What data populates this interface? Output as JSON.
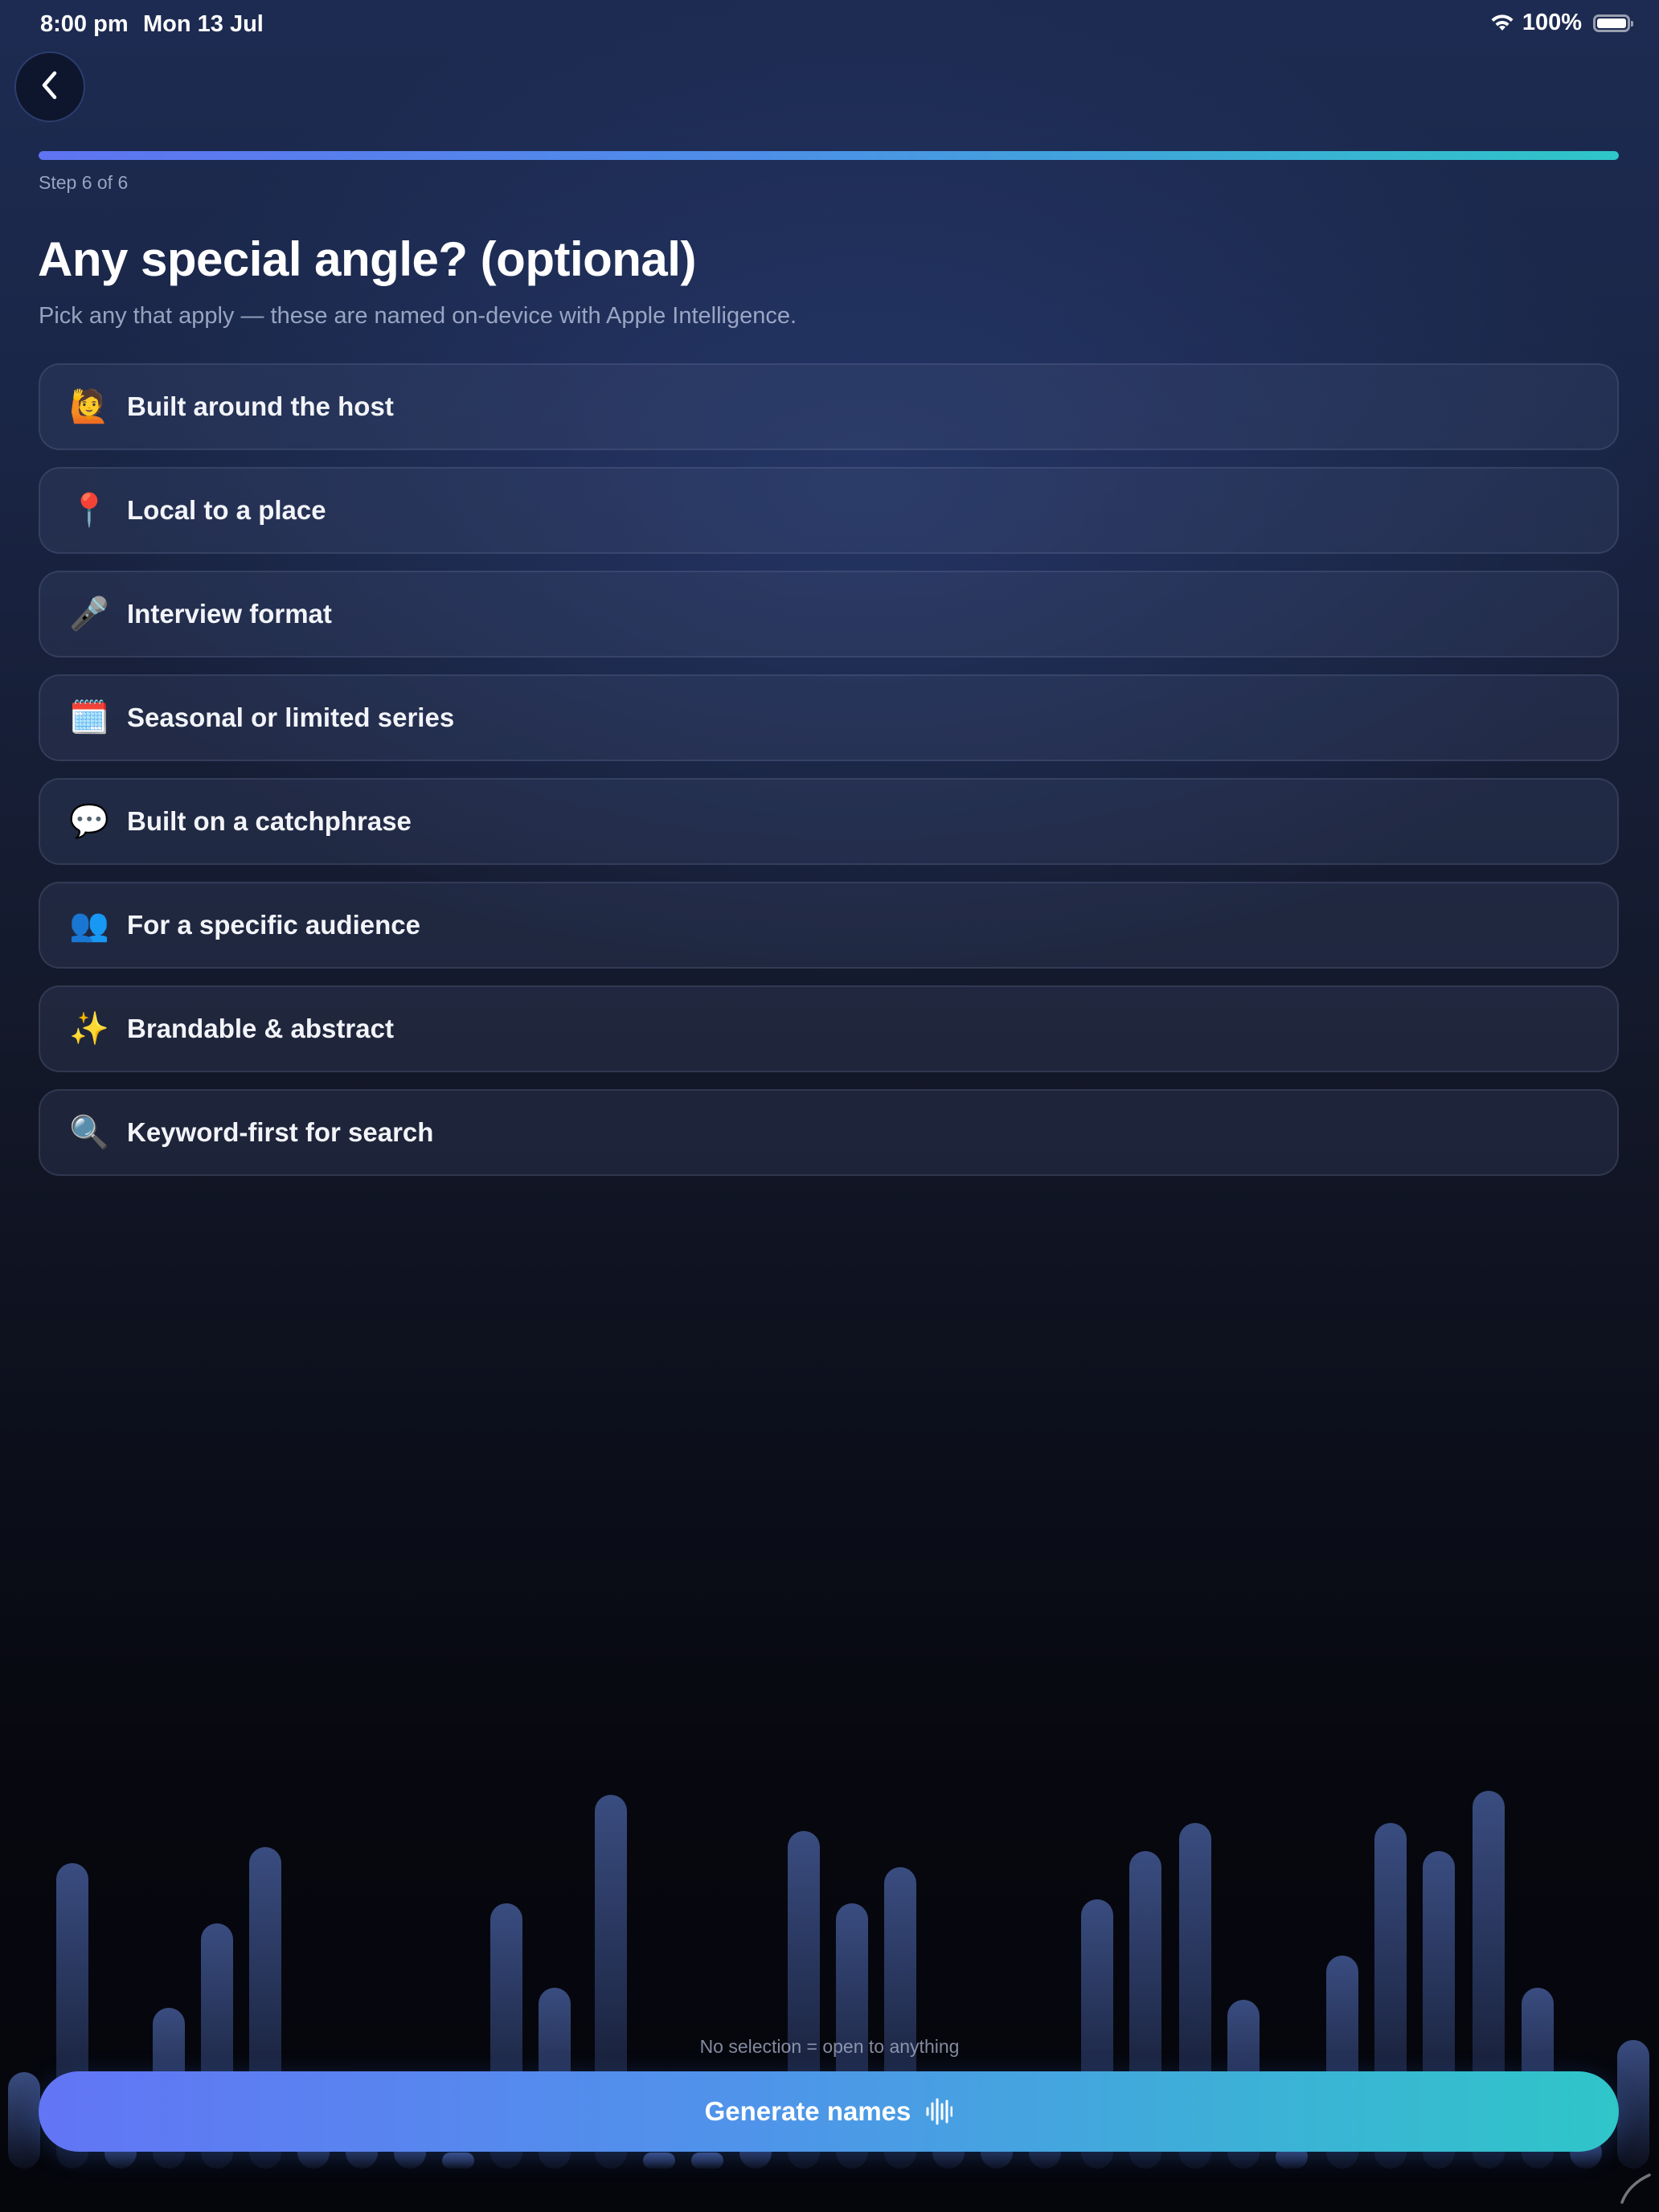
{
  "status_bar": {
    "time": "8:00 pm",
    "date": "Mon 13 Jul",
    "battery": "100%",
    "wifi_icon": "wifi-icon",
    "battery_icon": "battery-icon"
  },
  "nav": {
    "back_icon": "chevron-left-icon"
  },
  "progress": {
    "step_label": "Step 6 of 6",
    "fraction": 1.0,
    "colors": [
      "#5f74f2",
      "#2ec6c8"
    ]
  },
  "header": {
    "title": "Any special angle? (optional)",
    "subtitle": "Pick any that apply — these are named on-device with Apple Intelligence."
  },
  "options": [
    {
      "icon": "🙋",
      "icon_name": "person-raising-hand-icon",
      "label": "Built around the host"
    },
    {
      "icon": "📍",
      "icon_name": "round-pushpin-icon",
      "label": "Local to a place"
    },
    {
      "icon": "🎤",
      "icon_name": "microphone-icon",
      "label": "Interview format"
    },
    {
      "icon": "🗓️",
      "icon_name": "calendar-icon",
      "label": "Seasonal or limited series"
    },
    {
      "icon": "💬",
      "icon_name": "speech-bubble-icon",
      "label": "Built on a catchphrase"
    },
    {
      "icon": "👥",
      "icon_name": "people-icon",
      "label": "For a specific audience"
    },
    {
      "icon": "✨",
      "icon_name": "sparkles-icon",
      "label": "Brandable & abstract"
    },
    {
      "icon": "🔍",
      "icon_name": "magnifying-glass-icon",
      "label": "Keyword-first for search"
    }
  ],
  "footer": {
    "hint": "No selection = open to anything",
    "generate_label": "Generate names",
    "generate_icon": "waveform-icon",
    "button_colors": [
      "#6275f5",
      "#2fc6c9"
    ]
  },
  "colors": {
    "background_top": "#1d2b52",
    "background_bottom": "#05060c",
    "accent": "#4f94ea"
  }
}
